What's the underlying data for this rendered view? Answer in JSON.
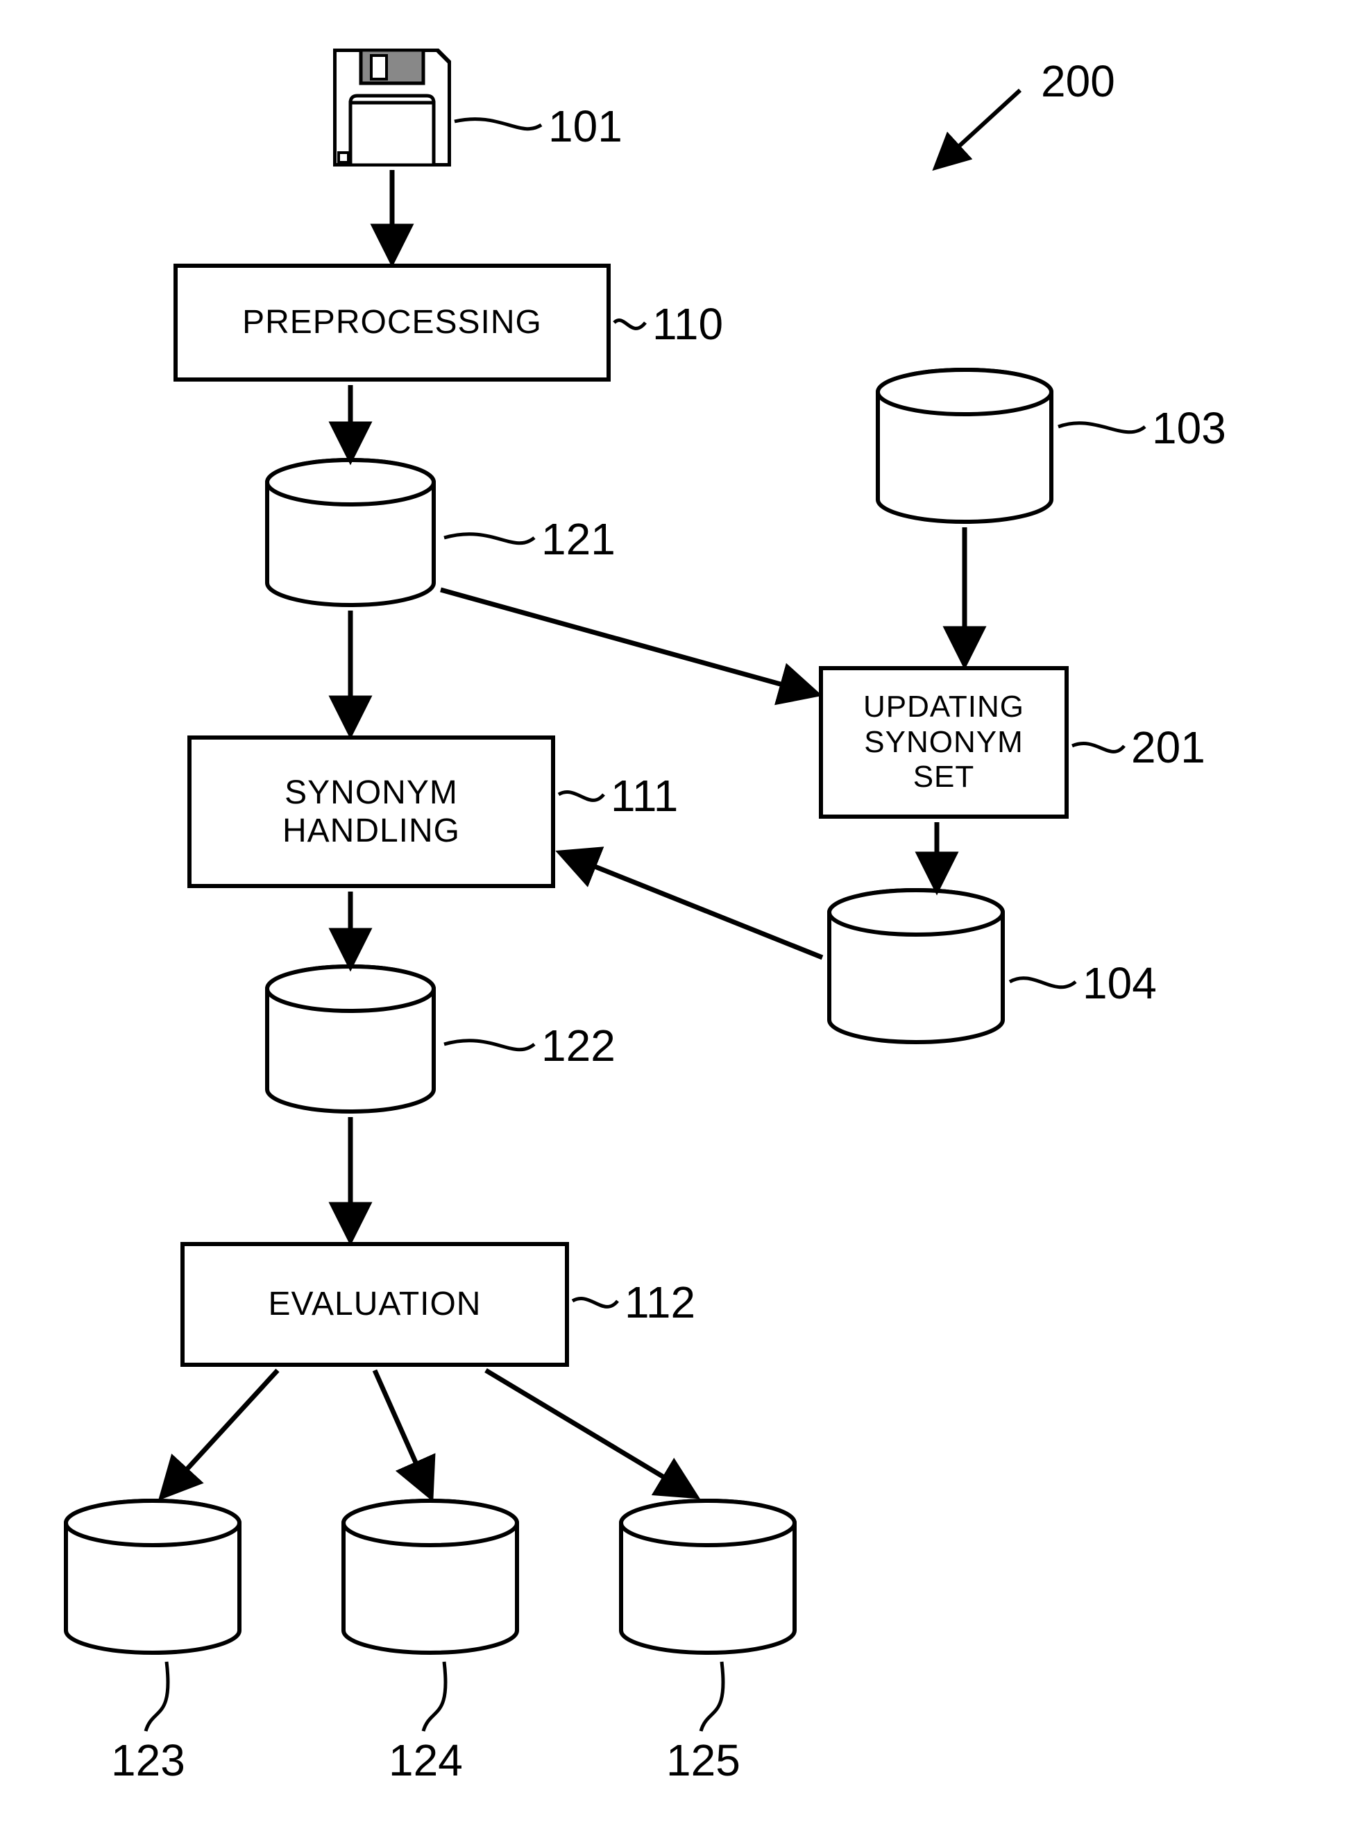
{
  "figure_ref": "200",
  "nodes": {
    "floppy": {
      "ref": "101"
    },
    "preprocessing": {
      "label": "PREPROCESSING",
      "ref": "110"
    },
    "db121": {
      "ref": "121"
    },
    "synonym_handling": {
      "label": "SYNONYM\nHANDLING",
      "ref": "111"
    },
    "db122": {
      "ref": "122"
    },
    "evaluation": {
      "label": "EVALUATION",
      "ref": "112"
    },
    "db123": {
      "ref": "123"
    },
    "db124": {
      "ref": "124"
    },
    "db125": {
      "ref": "125"
    },
    "db103": {
      "ref": "103"
    },
    "updating_synonym_set": {
      "label": "UPDATING\nSYNONYM\nSET",
      "ref": "201"
    },
    "db104": {
      "ref": "104"
    }
  }
}
